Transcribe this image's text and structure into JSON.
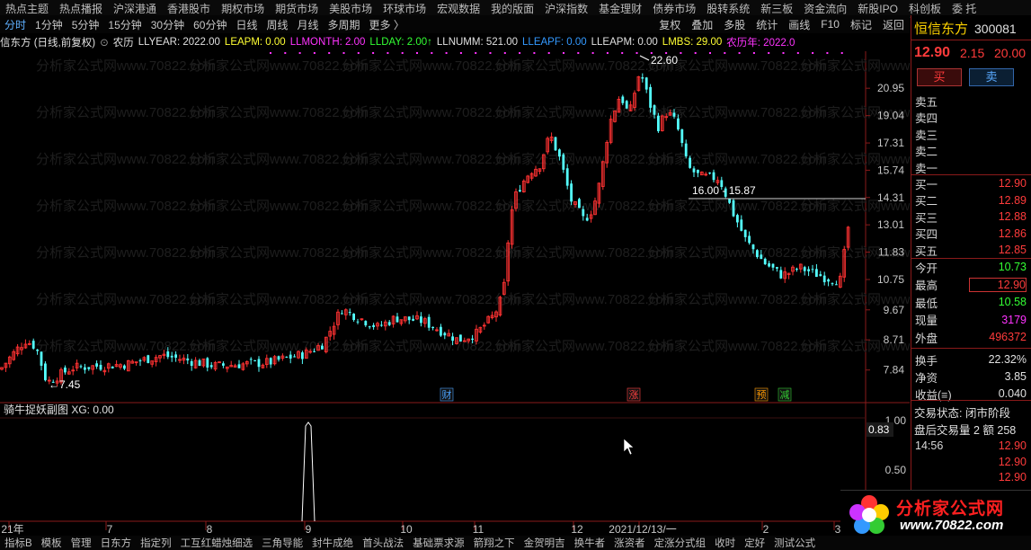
{
  "menu": [
    "热点主题",
    "热点播报",
    "沪深港通",
    "香港股市",
    "期权市场",
    "期货市场",
    "美股市场",
    "环球市场",
    "宏观数据",
    "我的版面",
    "沪深指数",
    "基金理财",
    "债券市场",
    "股转系统",
    "新三板",
    "资金流向",
    "新股IPO",
    "科创板",
    "委 托"
  ],
  "periods": [
    "分时",
    "1分钟",
    "5分钟",
    "15分钟",
    "30分钟",
    "60分钟",
    "日线",
    "周线",
    "月线",
    "多周期",
    "更多 〉"
  ],
  "right_tools": [
    "复权",
    "叠加",
    "多股",
    "统计",
    "画线",
    "F10",
    "标记",
    "返回"
  ],
  "indicator": {
    "name": "信东方 (日线,前复权)",
    "toggle": "农历",
    "items": [
      {
        "t": "LLYEAR: 2022.00",
        "c": "#e0e0e0"
      },
      {
        "t": "LEAPM: 0.00",
        "c": "#ffff33"
      },
      {
        "t": "LLMONTH: 2.00",
        "c": "#ff33ff"
      },
      {
        "t": "LLDAY: 2.00↑",
        "c": "#33ff33"
      },
      {
        "t": "LLNUMM: 521.00",
        "c": "#e0e0e0"
      },
      {
        "t": "LLEAPF: 0.00",
        "c": "#3399ff"
      },
      {
        "t": "LLEAPM: 0.00",
        "c": "#e0e0e0"
      },
      {
        "t": "LMBS: 29.00",
        "c": "#ffff33"
      },
      {
        "t": "农历年: 2022.0",
        "c": "#ff33ff"
      }
    ]
  },
  "chart_data": {
    "type": "candlestick",
    "price_axis": [
      "20.95",
      "19.04",
      "17.31",
      "15.74",
      "14.31",
      "13.01",
      "11.83",
      "10.75",
      "9.67",
      "8.71",
      "7.84"
    ],
    "date_axis": [
      "21年",
      "7",
      "8",
      "9",
      "10",
      "11",
      "12",
      "2021/12/13/一",
      "2",
      "3"
    ],
    "annotations": {
      "high": "22.60",
      "low": "7.45",
      "level": "16.00 - 15.87"
    },
    "markers": [
      {
        "t": "财",
        "c": "#4aa3ff"
      },
      {
        "t": "涨",
        "c": "#ff4040"
      },
      {
        "t": "预",
        "c": "#ff9900"
      },
      {
        "t": "减",
        "c": "#33cc33"
      }
    ],
    "sub": {
      "title": "骑牛捉妖副图 XG: 0.00",
      "axis": [
        "1.00",
        "0.50"
      ],
      "value": "0.83"
    },
    "colors": {
      "up": "#ff3232",
      "down": "#54ffff"
    }
  },
  "stock": {
    "name": "恒信东方",
    "code": "300081",
    "price": "12.90",
    "change": "2.15",
    "pct": "20.00"
  },
  "buttons": {
    "buy": "买",
    "sell": "卖"
  },
  "sell_labels": [
    "卖五",
    "卖四",
    "卖三",
    "卖二",
    "卖一"
  ],
  "buy_book": [
    {
      "l": "买一",
      "v": "12.90"
    },
    {
      "l": "买二",
      "v": "12.89"
    },
    {
      "l": "买三",
      "v": "12.88"
    },
    {
      "l": "买四",
      "v": "12.86"
    },
    {
      "l": "买五",
      "v": "12.85"
    }
  ],
  "quote": [
    {
      "l": "今开",
      "v": "10.73",
      "c": "#33ff33"
    },
    {
      "l": "最高",
      "v": "12.90",
      "c": "#ff3b3b",
      "box": true
    },
    {
      "l": "最低",
      "v": "10.58",
      "c": "#33ff33"
    },
    {
      "l": "现量",
      "v": "3179",
      "c": "#ff33ff"
    },
    {
      "l": "外盘",
      "v": "496372",
      "c": "#ff3b3b"
    },
    {
      "l": "换手",
      "v": "22.32%",
      "c": "#e0e0e0"
    },
    {
      "l": "净资",
      "v": "3.85",
      "c": "#e0e0e0"
    },
    {
      "l": "收益(≡)",
      "v": "0.040",
      "c": "#e0e0e0"
    }
  ],
  "trade": {
    "status": "交易状态: 闭市阶段",
    "after": "盘后交易量 2 额 258",
    "ticks": [
      {
        "t": "14:56",
        "v": "12.90"
      },
      {
        "t": "",
        "v": "12.90"
      },
      {
        "t": "",
        "v": "12.90"
      }
    ]
  },
  "bottom_tabs": [
    "指标B",
    "模板",
    "管理",
    "日东方",
    "指定列",
    "工互红蜡烛细选",
    "三角导能",
    "封牛成绝",
    "首头战法",
    "基础票求源",
    "箭翔之下",
    "金贺明吉",
    "换牛者",
    "涨资者",
    "定涨分式组",
    "收时",
    "定好",
    "测试公式"
  ],
  "logo": {
    "title": "分析家公式网",
    "url": "www.70822.com"
  }
}
